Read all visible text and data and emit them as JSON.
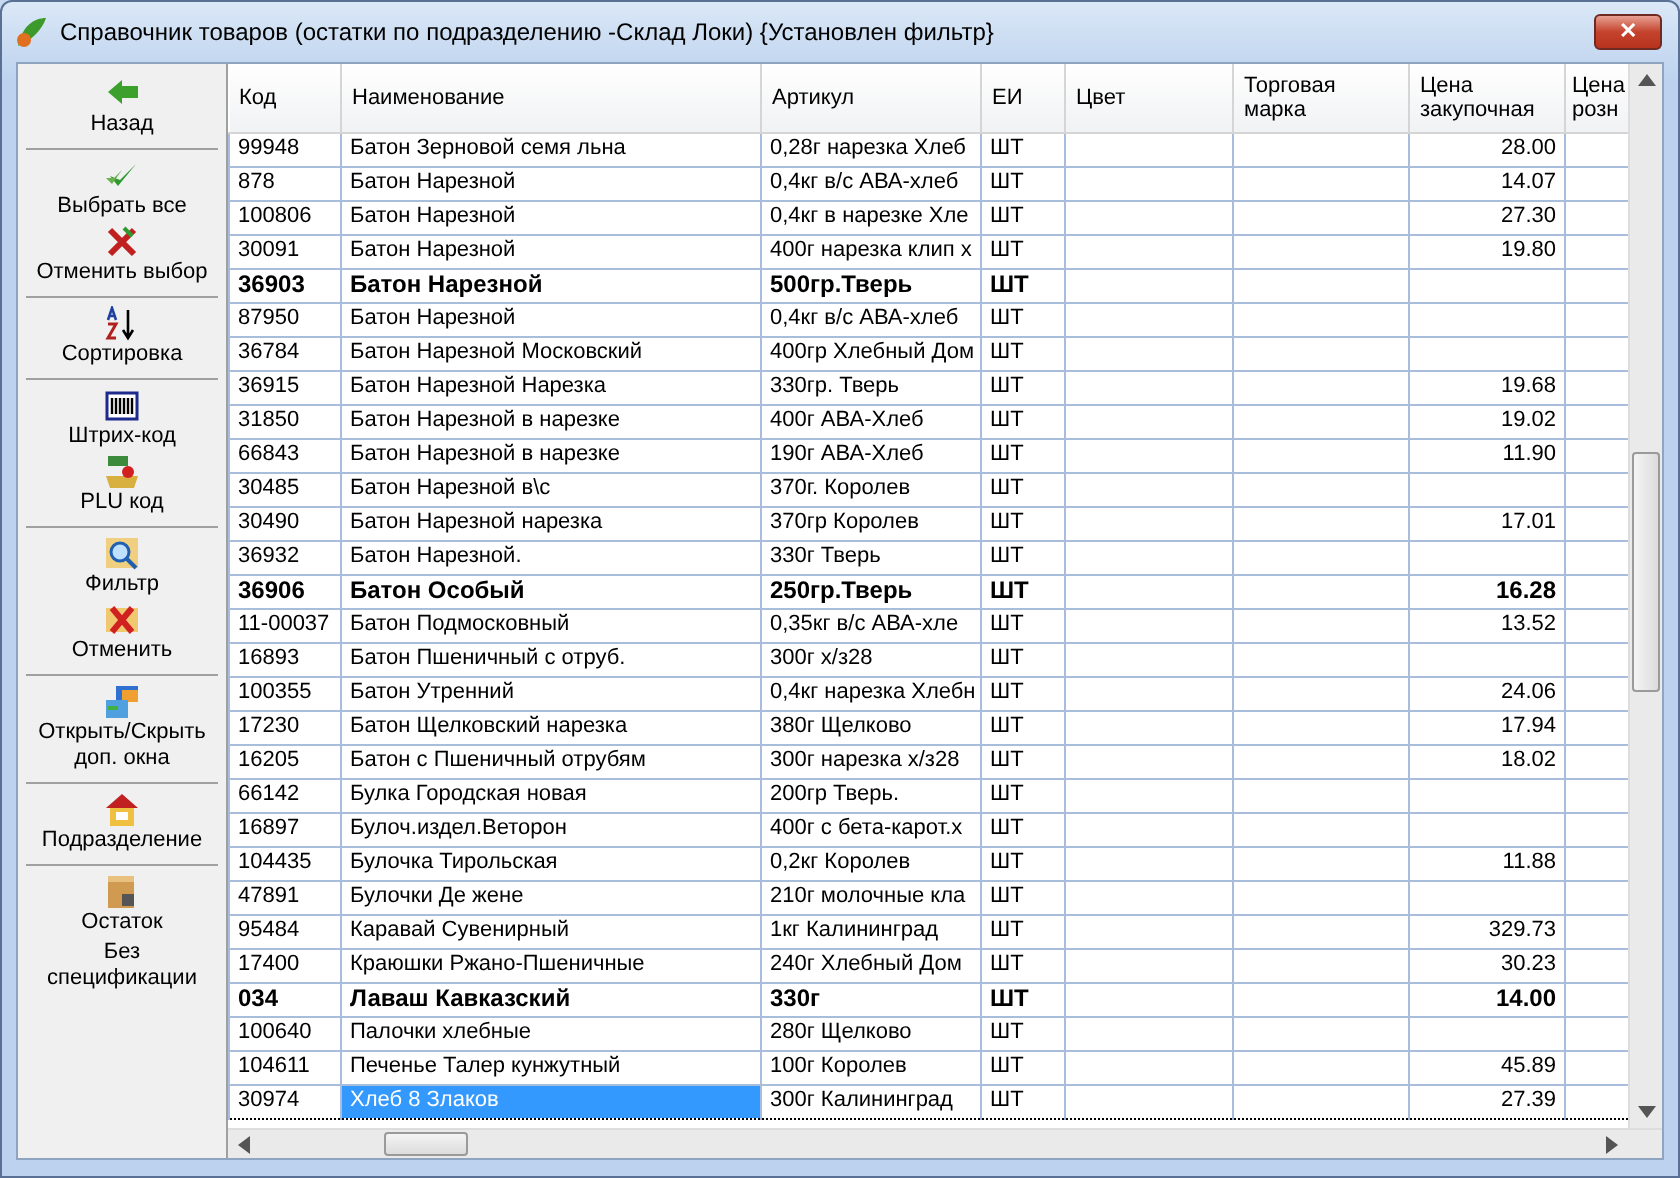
{
  "window": {
    "title": "Справочник товаров (остатки по подразделению -Склад Локи) {Установлен фильтр}",
    "close": "✕"
  },
  "sidebar": {
    "groups": [
      [
        {
          "label": "Назад"
        }
      ],
      [
        {
          "label": "Выбрать все"
        },
        {
          "label": "Отменить выбор"
        }
      ],
      [
        {
          "label": "Сортировка"
        }
      ],
      [
        {
          "label": "Штрих-код"
        },
        {
          "label": "PLU код"
        }
      ],
      [
        {
          "label": "Фильтр"
        },
        {
          "label": "Отменить"
        }
      ],
      [
        {
          "label": "Открыть/Скрыть доп. окна"
        }
      ],
      [
        {
          "label": "Подразделение"
        }
      ],
      [
        {
          "label": "Остаток"
        },
        {
          "label": "Без спецификации"
        }
      ]
    ]
  },
  "table": {
    "columns": [
      "Код",
      "Наименование",
      "Артикул",
      "ЕИ",
      "Цвет",
      "Торговая марка",
      "Цена закупочная",
      "Цена розн"
    ],
    "rows": [
      {
        "code": "99948",
        "name": "Батон Зерновой семя льна",
        "article": "0,28г нарезка Хлеб",
        "unit": "ШТ",
        "price": "28.00",
        "bold": false,
        "selected": false
      },
      {
        "code": "878",
        "name": "Батон Нарезной",
        "article": "0,4кг в/с АВА-хлеб",
        "unit": "ШТ",
        "price": "14.07",
        "bold": false,
        "selected": false
      },
      {
        "code": "100806",
        "name": "Батон Нарезной",
        "article": "0,4кг в нарезке Хле",
        "unit": "ШТ",
        "price": "27.30",
        "bold": false,
        "selected": false
      },
      {
        "code": "30091",
        "name": "Батон Нарезной",
        "article": "400г нарезка клип х",
        "unit": "ШТ",
        "price": "19.80",
        "bold": false,
        "selected": false
      },
      {
        "code": "36903",
        "name": "Батон Нарезной",
        "article": "500гр.Тверь",
        "unit": "ШТ",
        "price": "",
        "bold": true,
        "selected": false
      },
      {
        "code": "87950",
        "name": "Батон Нарезной",
        "article": "0,4кг в/с АВА-хлеб",
        "unit": "ШТ",
        "price": "",
        "bold": false,
        "selected": false
      },
      {
        "code": "36784",
        "name": "Батон Нарезной Московский",
        "article": "400гр Хлебный Дом",
        "unit": "ШТ",
        "price": "",
        "bold": false,
        "selected": false
      },
      {
        "code": "36915",
        "name": "Батон Нарезной Нарезка",
        "article": "330гр. Тверь",
        "unit": "ШТ",
        "price": "19.68",
        "bold": false,
        "selected": false
      },
      {
        "code": "31850",
        "name": "Батон Нарезной в нарезке",
        "article": "400г АВА-Хлеб",
        "unit": "ШТ",
        "price": "19.02",
        "bold": false,
        "selected": false
      },
      {
        "code": "66843",
        "name": "Батон Нарезной в нарезке",
        "article": "190г АВА-Хлеб",
        "unit": "ШТ",
        "price": "11.90",
        "bold": false,
        "selected": false
      },
      {
        "code": "30485",
        "name": "Батон Нарезной в\\с",
        "article": "370г. Королев",
        "unit": "ШТ",
        "price": "",
        "bold": false,
        "selected": false
      },
      {
        "code": "30490",
        "name": "Батон Нарезной нарезка",
        "article": "370гр Королев",
        "unit": "ШТ",
        "price": "17.01",
        "bold": false,
        "selected": false
      },
      {
        "code": "36932",
        "name": "Батон Нарезной.",
        "article": "330г  Тверь",
        "unit": "ШТ",
        "price": "",
        "bold": false,
        "selected": false
      },
      {
        "code": "36906",
        "name": "Батон Особый",
        "article": "250гр.Тверь",
        "unit": "ШТ",
        "price": "16.28",
        "bold": true,
        "selected": false
      },
      {
        "code": "11-00037",
        "name": "Батон Подмосковный",
        "article": "0,35кг в/с АВА-хле",
        "unit": "ШТ",
        "price": "13.52",
        "bold": false,
        "selected": false
      },
      {
        "code": "16893",
        "name": "Батон Пшеничный  с отруб.",
        "article": "300г  х/з28",
        "unit": "ШТ",
        "price": "",
        "bold": false,
        "selected": false
      },
      {
        "code": "100355",
        "name": "Батон Утренний",
        "article": "0,4кг нарезка Хлебн",
        "unit": "ШТ",
        "price": "24.06",
        "bold": false,
        "selected": false
      },
      {
        "code": "17230",
        "name": "Батон Щелковский нарезка",
        "article": "380г Щелково",
        "unit": "ШТ",
        "price": "17.94",
        "bold": false,
        "selected": false
      },
      {
        "code": "16205",
        "name": "Батон с Пшеничный отрубям",
        "article": "300г нарезка х/з28",
        "unit": "ШТ",
        "price": "18.02",
        "bold": false,
        "selected": false
      },
      {
        "code": "66142",
        "name": "Булка Городская новая",
        "article": "200гр Тверь.",
        "unit": "ШТ",
        "price": "",
        "bold": false,
        "selected": false
      },
      {
        "code": "16897",
        "name": "Булоч.издел.Веторон",
        "article": "400г с бета-карот.х",
        "unit": "ШТ",
        "price": "",
        "bold": false,
        "selected": false
      },
      {
        "code": "104435",
        "name": "Булочка Тирольская",
        "article": "0,2кг Королев",
        "unit": "ШТ",
        "price": "11.88",
        "bold": false,
        "selected": false
      },
      {
        "code": "47891",
        "name": "Булочки Де жене",
        "article": "210г молочные кла",
        "unit": "ШТ",
        "price": "",
        "bold": false,
        "selected": false
      },
      {
        "code": "95484",
        "name": "Каравай Сувенирный",
        "article": "1кг Калининград",
        "unit": "ШТ",
        "price": "329.73",
        "bold": false,
        "selected": false
      },
      {
        "code": "17400",
        "name": "Краюшки Ржано-Пшеничные",
        "article": "240г  Хлебный Дом",
        "unit": "ШТ",
        "price": "30.23",
        "bold": false,
        "selected": false
      },
      {
        "code": "034",
        "name": "Лаваш Кавказский",
        "article": "330г",
        "unit": "ШТ",
        "price": "14.00",
        "bold": true,
        "selected": false
      },
      {
        "code": "100640",
        "name": "Палочки хлебные",
        "article": "280г Щелково",
        "unit": "ШТ",
        "price": "",
        "bold": false,
        "selected": false
      },
      {
        "code": "104611",
        "name": "Печенье Талер кунжутный",
        "article": "100г Королев",
        "unit": "ШТ",
        "price": "45.89",
        "bold": false,
        "selected": false
      },
      {
        "code": "30974",
        "name": "Хлеб 8 Злаков",
        "article": "300г Калининград",
        "unit": "ШТ",
        "price": "27.39",
        "bold": false,
        "selected": true
      }
    ]
  }
}
